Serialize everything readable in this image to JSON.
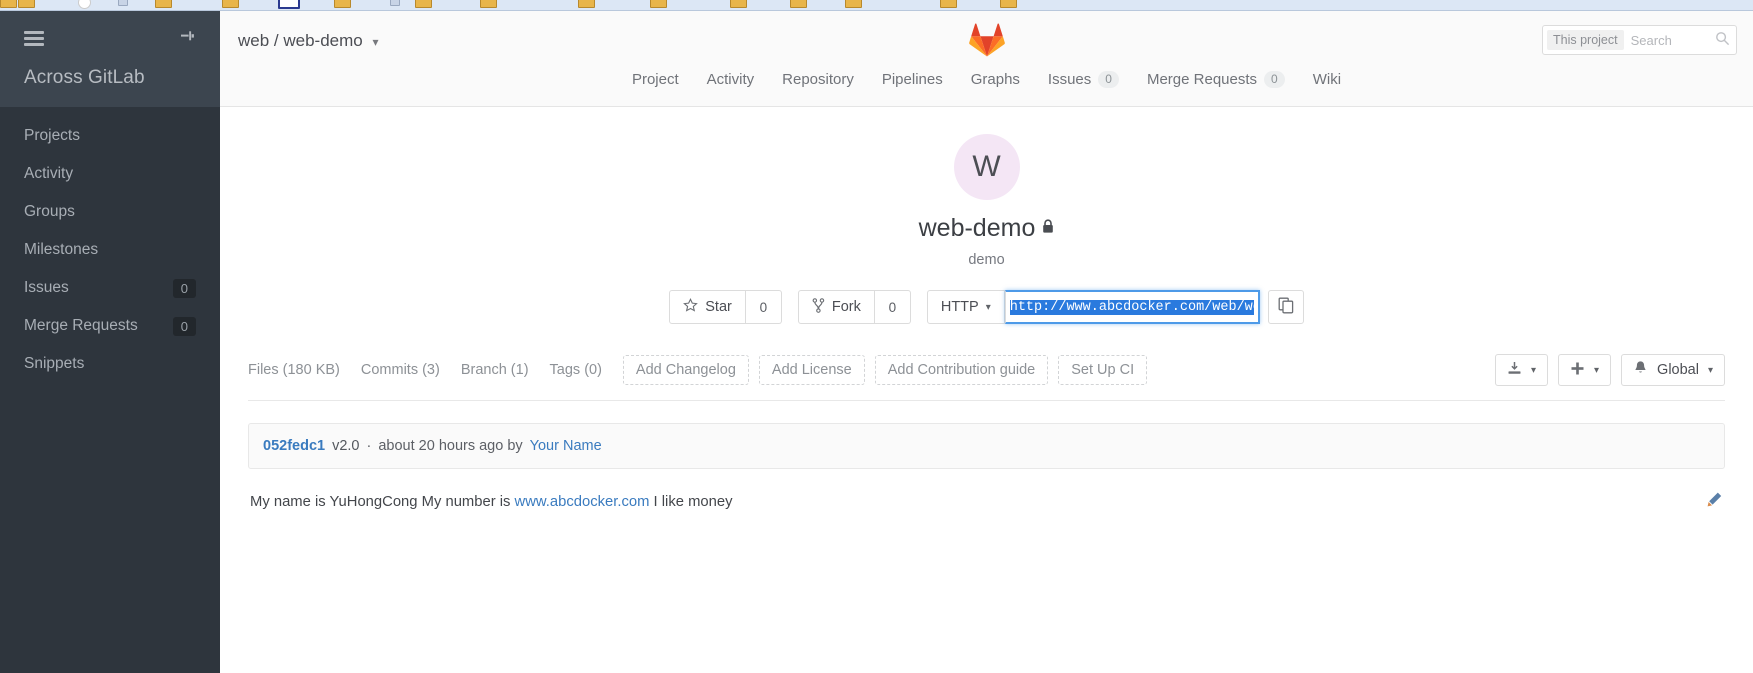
{
  "browser": {
    "bookmark_icons": [
      "folder-icon",
      "circle-icon",
      "folder-icon",
      "folder-icon",
      "folder-icon",
      "tab-icon",
      "folder-icon",
      "folder-icon",
      "folder-icon",
      "folder-icon",
      "folder-icon",
      "folder-icon",
      "folder-icon",
      "folder-icon"
    ]
  },
  "sidebar": {
    "title": "Across GitLab",
    "hamburger_icon": "hamburger-icon",
    "pin_icon": "pin-icon",
    "items": [
      {
        "label": "Projects",
        "badge": ""
      },
      {
        "label": "Activity",
        "badge": ""
      },
      {
        "label": "Groups",
        "badge": ""
      },
      {
        "label": "Milestones",
        "badge": ""
      },
      {
        "label": "Issues",
        "badge": "0"
      },
      {
        "label": "Merge Requests",
        "badge": "0"
      },
      {
        "label": "Snippets",
        "badge": ""
      }
    ]
  },
  "navbar": {
    "breadcrumb": "web / web-demo",
    "breadcrumb_chevron": "⌄",
    "logo_icon": "gitlab-logo-icon",
    "tabs": [
      {
        "label": "Project",
        "badge": ""
      },
      {
        "label": "Activity",
        "badge": ""
      },
      {
        "label": "Repository",
        "badge": ""
      },
      {
        "label": "Pipelines",
        "badge": ""
      },
      {
        "label": "Graphs",
        "badge": ""
      },
      {
        "label": "Issues",
        "badge": "0"
      },
      {
        "label": "Merge Requests",
        "badge": "0"
      },
      {
        "label": "Wiki",
        "badge": ""
      }
    ],
    "search": {
      "scope": "This project",
      "placeholder": "Search",
      "value": "",
      "icon": "search-icon"
    }
  },
  "project": {
    "avatar_initial": "W",
    "avatar_color": "#f4e6f5",
    "name": "web-demo",
    "visibility_icon": "lock-icon",
    "description": "demo",
    "star": {
      "label": "Star",
      "icon": "star-icon",
      "count": "0"
    },
    "fork": {
      "label": "Fork",
      "icon": "fork-icon",
      "count": "0"
    },
    "clone": {
      "protocol": "HTTP",
      "url": "http://www.abcdocker.com/web/web-demo.git",
      "copy_icon": "copy-icon"
    }
  },
  "toolbar": {
    "stats": [
      {
        "label": "Files (180 KB)"
      },
      {
        "label": "Commits (3)"
      },
      {
        "label": "Branch (1)"
      },
      {
        "label": "Tags (0)"
      }
    ],
    "dashed_actions": [
      {
        "label": "Add Changelog"
      },
      {
        "label": "Add License"
      },
      {
        "label": "Add Contribution guide"
      },
      {
        "label": "Set Up CI"
      }
    ],
    "right_actions": [
      {
        "label": "",
        "icon": "download-icon",
        "caret": "▾"
      },
      {
        "label": "",
        "icon": "plus-icon",
        "caret": "▾"
      },
      {
        "label": "Global",
        "icon": "bell-icon",
        "caret": "▾"
      }
    ]
  },
  "commit": {
    "sha": "052fedc1",
    "message": "v2.0",
    "separator": "·",
    "time": "about 20 hours ago by",
    "author": "Your Name"
  },
  "readme": {
    "text_before": "My name is YuHongCong My number is ",
    "link": "www.abcdocker.com",
    "text_after": " I like money",
    "edit_icon": "pencil-icon"
  },
  "accent": {
    "link_blue": "#3a7bbf",
    "focus_blue": "#4d9ae8",
    "sidebar_bg": "#2e353d"
  }
}
